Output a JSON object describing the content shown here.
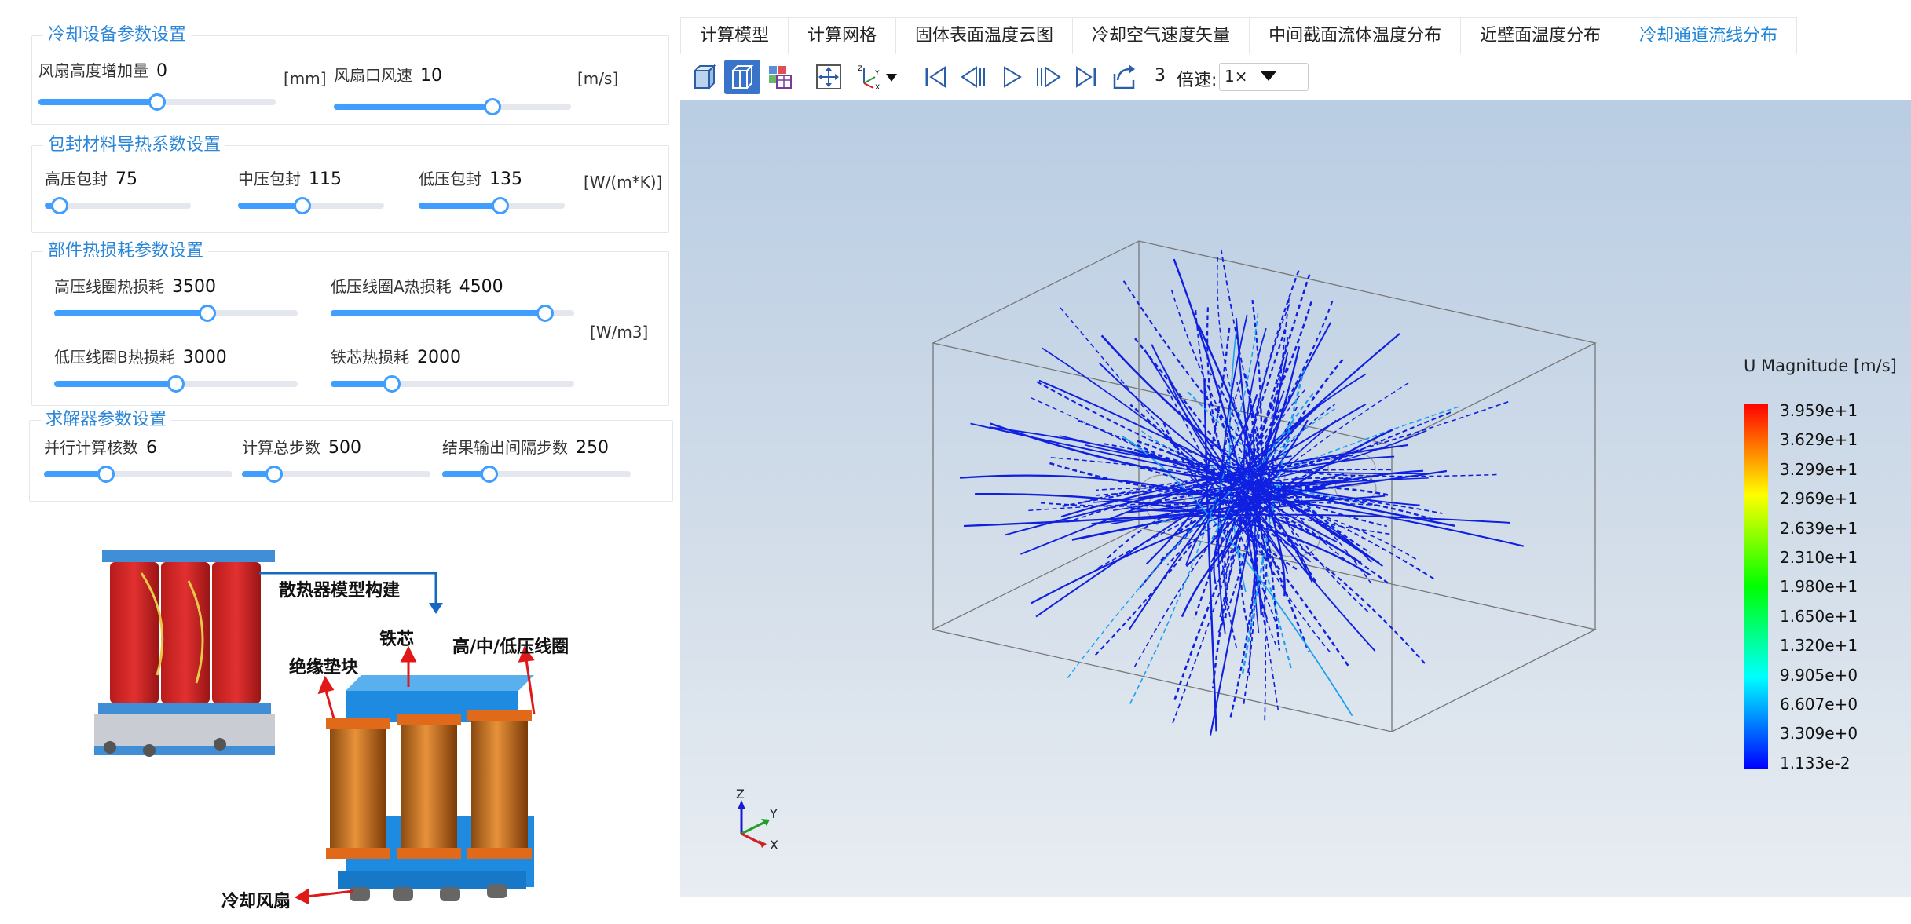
{
  "cooling": {
    "title": "冷却设备参数设置",
    "fan_height": {
      "label": "风扇高度增加量",
      "value": "0",
      "level": 0.5
    },
    "fan_height_unit": "[mm]",
    "fan_speed": {
      "label": "风扇口风速",
      "value": "10",
      "level": 0.67
    },
    "fan_speed_unit": "[m/s]"
  },
  "encap": {
    "title": "包封材料导热系数设置",
    "high": {
      "label": "高压包封",
      "value": "75",
      "level": 0.1
    },
    "mid": {
      "label": "中压包封",
      "value": "115",
      "level": 0.44
    },
    "low": {
      "label": "低压包封",
      "value": "135",
      "level": 0.56
    },
    "unit": "[W/(m*K)]"
  },
  "loss": {
    "title": "部件热损耗参数设置",
    "high_coil": {
      "label": "高压线圈热损耗",
      "value": "3500",
      "level": 0.63
    },
    "low_coil_a": {
      "label": "低压线圈A热损耗",
      "value": "4500",
      "level": 0.88
    },
    "low_coil_b": {
      "label": "低压线圈B热损耗",
      "value": "3000",
      "level": 0.5
    },
    "core": {
      "label": "铁芯热损耗",
      "value": "2000",
      "level": 0.25
    },
    "unit": "[W/m3]"
  },
  "solver": {
    "title": "求解器参数设置",
    "cores": {
      "label": "并行计算核数",
      "value": "6",
      "level": 0.33
    },
    "steps": {
      "label": "计算总步数",
      "value": "500",
      "level": 0.17
    },
    "interval": {
      "label": "结果输出间隔步数",
      "value": "250",
      "level": 0.25
    }
  },
  "diagram": {
    "label_model": "散热器模型构建",
    "label_core": "铁芯",
    "label_coils": "高/中/低压线圈",
    "label_insulation": "绝缘垫块",
    "label_fan": "冷却风扇"
  },
  "tabs": [
    "计算模型",
    "计算网格",
    "固体表面温度云图",
    "冷却空气速度矢量",
    "中间截面流体温度分布",
    "近壁面温度分布",
    "冷却通道流线分布"
  ],
  "active_tab": 6,
  "toolbar": {
    "frame": "3",
    "speed_label": "倍速:",
    "speed_value": "1×"
  },
  "legend": {
    "title": "U Magnitude [m/s]",
    "labels": [
      "3.959e+1",
      "3.629e+1",
      "3.299e+1",
      "2.969e+1",
      "2.639e+1",
      "2.310e+1",
      "1.980e+1",
      "1.650e+1",
      "1.320e+1",
      "9.905e+0",
      "6.607e+0",
      "3.309e+0",
      "1.133e-2"
    ]
  },
  "axes": {
    "z": "Z",
    "y": "Y",
    "x": "X"
  },
  "colors": {
    "accent": "#409eff",
    "title_blue": "#2a86d8",
    "streamline": "#1020e0"
  }
}
